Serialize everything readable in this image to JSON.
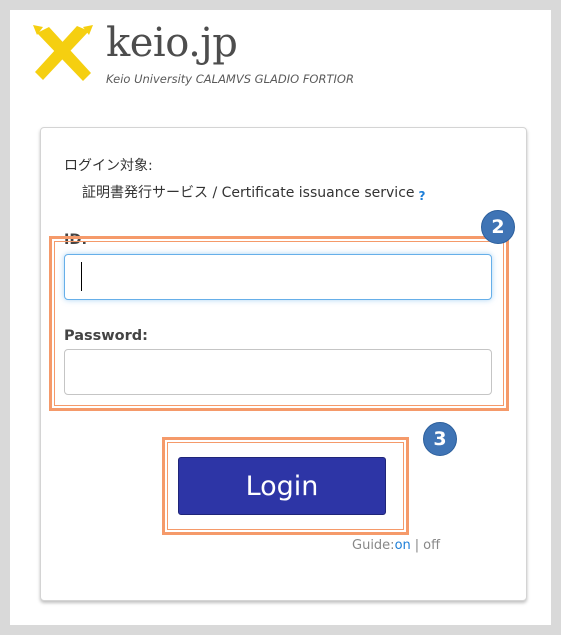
{
  "header": {
    "logo_title": "keio.jp",
    "logo_subtitle": "Keio University CALAMVS GLADIO FORTIOR"
  },
  "login": {
    "target_label": "ログイン対象:",
    "service_name": "証明書発行サービス / Certificate issuance service",
    "help_icon": "?",
    "id_label": "ID:",
    "id_value": "",
    "password_label": "Password:",
    "password_value": "",
    "button_label": "Login"
  },
  "guide": {
    "label": "Guide:",
    "on": "on",
    "separator": "|",
    "off": "off"
  },
  "annotations": {
    "step2": "2",
    "step3": "3"
  },
  "colors": {
    "highlight": "#f59a6a",
    "badge": "#3f74b5",
    "button": "#2d35a6",
    "logo_yellow": "#f5cf10"
  }
}
